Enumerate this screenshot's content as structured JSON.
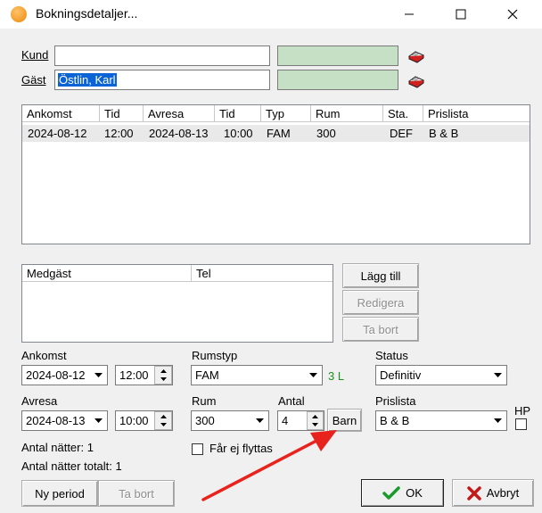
{
  "window": {
    "title": "Bokningsdetaljer..."
  },
  "customer": {
    "kund_label": "Kund",
    "kund_value": "",
    "gast_label": "Gäst",
    "gast_value": "Östlin, Karl"
  },
  "bookings": {
    "columns": [
      "Ankomst",
      "Tid",
      "Avresa",
      "Tid",
      "Typ",
      "Rum",
      "Sta.",
      "Prislista"
    ],
    "rows": [
      [
        "2024-08-12",
        "12:00",
        "2024-08-13",
        "10:00",
        "FAM",
        "300",
        "DEF",
        "B & B"
      ]
    ]
  },
  "guests": {
    "columns": [
      "Medgäst",
      "Tel"
    ]
  },
  "guest_buttons": {
    "add": "Lägg till",
    "edit": "Redigera",
    "remove": "Ta bort"
  },
  "form": {
    "ankomst_label": "Ankomst",
    "ankomst_date": "2024-08-12",
    "ankomst_time": "12:00",
    "avresa_label": "Avresa",
    "avresa_date": "2024-08-13",
    "avresa_time": "10:00",
    "rumstyp_label": "Rumstyp",
    "rumstyp_value": "FAM",
    "rumstyp_count": "3 L",
    "rum_label": "Rum",
    "rum_value": "300",
    "antal_label": "Antal",
    "antal_value": "4",
    "barn_button": "Barn",
    "status_label": "Status",
    "status_value": "Definitiv",
    "prislista_label": "Prislista",
    "prislista_value": "B & B",
    "hp_label": "HP",
    "no_move_label": "Får ej flyttas",
    "nights": "Antal nätter: 1",
    "nights_total": "Antal nätter totalt: 1"
  },
  "footer": {
    "new_period": "Ny period",
    "remove": "Ta bort",
    "ok": "OK",
    "cancel": "Avbryt"
  },
  "colors": {
    "accent": "#0a64d6",
    "green_field": "#c6e0c6",
    "arrow": "#e8231d",
    "ok_check": "#1a9a2a",
    "cancel_x": "#c41818"
  }
}
